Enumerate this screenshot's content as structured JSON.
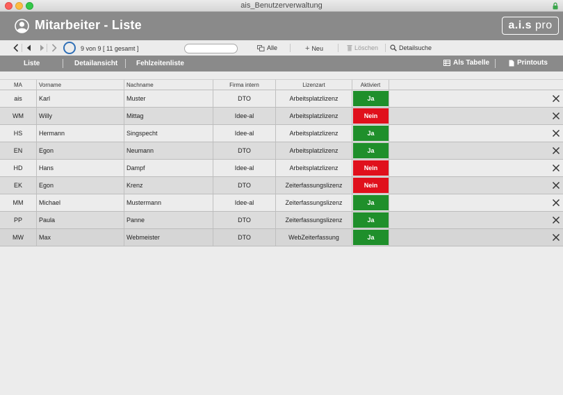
{
  "window": {
    "title": "ais_Benutzerverwaltung"
  },
  "header": {
    "title": "Mitarbeiter - Liste",
    "logo_bold": "a.i.s",
    "logo_light": "pro"
  },
  "toolbar": {
    "record_count": "9 von 9  [ 11 gesamt ]",
    "search_value": "",
    "all_label": "Alle",
    "new_label": "Neu",
    "delete_label": "Löschen",
    "detail_search_label": "Detailsuche"
  },
  "tabs": {
    "list": "Liste",
    "detail": "Detailansicht",
    "absence": "Fehlzeitenliste",
    "as_table": "Als Tabelle",
    "printouts": "Printouts"
  },
  "table": {
    "columns": {
      "ma": "MA",
      "vorname": "Vorname",
      "nachname": "Nachname",
      "firma": "Firma intern",
      "lizenz": "Lizenzart",
      "aktiviert": "Aktiviert"
    },
    "rows": [
      {
        "ma": "ais",
        "vorname": "Karl",
        "nachname": "Muster",
        "firma": "DTO",
        "lizenz": "Arbeitsplatzlizenz",
        "aktiviert": "Ja"
      },
      {
        "ma": "WM",
        "vorname": "Willy",
        "nachname": "Mittag",
        "firma": "Idee-al",
        "lizenz": "Arbeitsplatzlizenz",
        "aktiviert": "Nein"
      },
      {
        "ma": "HS",
        "vorname": "Hermann",
        "nachname": "Singspecht",
        "firma": "Idee-al",
        "lizenz": "Arbeitsplatzlizenz",
        "aktiviert": "Ja"
      },
      {
        "ma": "EN",
        "vorname": "Egon",
        "nachname": "Neumann",
        "firma": "DTO",
        "lizenz": "Arbeitsplatzlizenz",
        "aktiviert": "Ja"
      },
      {
        "ma": "HD",
        "vorname": "Hans",
        "nachname": "Dampf",
        "firma": "Idee-al",
        "lizenz": "Arbeitsplatzlizenz",
        "aktiviert": "Nein"
      },
      {
        "ma": "EK",
        "vorname": "Egon",
        "nachname": "Krenz",
        "firma": "DTO",
        "lizenz": "Zeiterfassungslizenz",
        "aktiviert": "Nein"
      },
      {
        "ma": "MM",
        "vorname": "Michael",
        "nachname": "Mustermann",
        "firma": "Idee-al",
        "lizenz": "Zeiterfassungslizenz",
        "aktiviert": "Ja"
      },
      {
        "ma": "PP",
        "vorname": "Paula",
        "nachname": "Panne",
        "firma": "DTO",
        "lizenz": "Zeiterfassungslizenz",
        "aktiviert": "Ja"
      },
      {
        "ma": "MW",
        "vorname": "Max",
        "nachname": "Webmeister",
        "firma": "DTO",
        "lizenz": "WebZeiterfassung",
        "aktiviert": "Ja"
      }
    ]
  },
  "colors": {
    "header_bg": "#8a8a8a",
    "yes_bg": "#1f8f2b",
    "no_bg": "#e0101c",
    "spinner": "#2f6fb6"
  }
}
